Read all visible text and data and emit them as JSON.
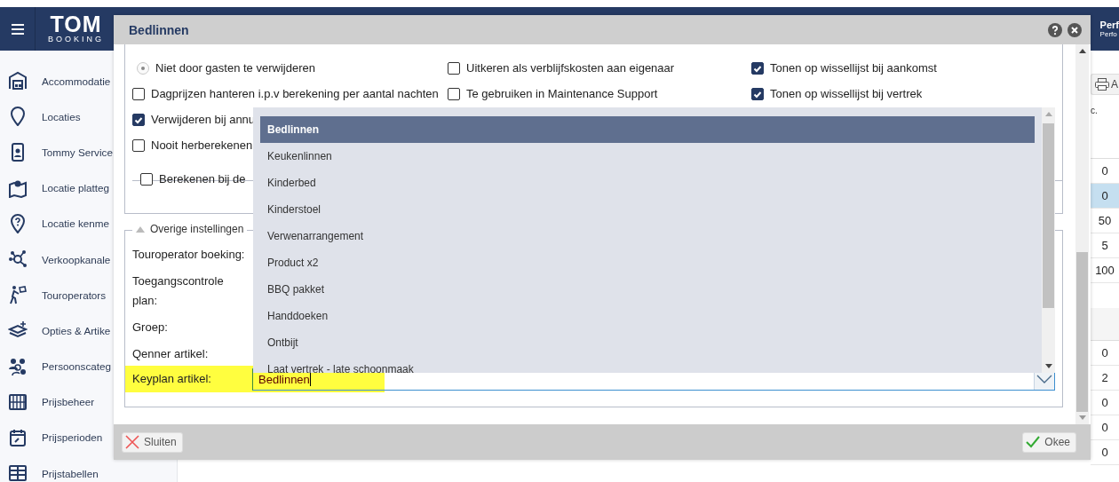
{
  "header": {
    "logo_title": "TOM",
    "logo_subtitle": "BOOKING",
    "user_name": "Perf",
    "user_role": "Perfo"
  },
  "sidebar": {
    "items": [
      {
        "label": "Accommodatie"
      },
      {
        "label": "Locaties"
      },
      {
        "label": "Tommy Service"
      },
      {
        "label": "Locatie platteg"
      },
      {
        "label": "Locatie kenme"
      },
      {
        "label": "Verkoopkanale"
      },
      {
        "label": "Touroperators"
      },
      {
        "label": "Opties & Artike"
      },
      {
        "label": "Persoonscateg"
      },
      {
        "label": "Prijsbeheer"
      },
      {
        "label": "Prijsperioden"
      },
      {
        "label": "Prijstabellen"
      }
    ]
  },
  "background_table": {
    "toolbar_button": "A",
    "column_header": "c.",
    "rows": [
      {
        "value": "0",
        "selected": false
      },
      {
        "value": "0",
        "selected": true
      },
      {
        "value": "50",
        "selected": false
      },
      {
        "value": "5",
        "selected": false
      },
      {
        "value": "100",
        "selected": false
      }
    ],
    "rows_below": [
      {
        "value": "0",
        "selected": false
      },
      {
        "value": "2",
        "selected": false
      },
      {
        "value": "0",
        "selected": false
      },
      {
        "value": "0",
        "selected": false
      },
      {
        "value": "0",
        "selected": false
      }
    ]
  },
  "dialog": {
    "title": "Bedlinnen",
    "option_rows": [
      {
        "cells": [
          {
            "kind": "radio",
            "label": "Niet door gasten te verwijderen",
            "checked": true
          },
          {
            "kind": "checkbox",
            "label": "Uitkeren als verblijfskosten aan eigenaar",
            "checked": false
          },
          {
            "kind": "checkbox",
            "label": "Tonen op wissellijst bij aankomst",
            "checked": true
          }
        ]
      },
      {
        "cells": [
          {
            "kind": "checkbox",
            "label": "Dagprijzen hanteren i.p.v berekening per aantal nachten",
            "checked": false
          },
          {
            "kind": "checkbox",
            "label": "Te gebruiken in Maintenance Support",
            "checked": false
          },
          {
            "kind": "checkbox",
            "label": "Tonen op wissellijst bij vertrek",
            "checked": true
          }
        ]
      },
      {
        "cells": [
          {
            "kind": "checkbox",
            "label": "Verwijderen bij annu",
            "checked": true
          }
        ]
      },
      {
        "cells": [
          {
            "kind": "checkbox",
            "label": "Nooit herberekenen",
            "checked": false
          }
        ]
      }
    ],
    "calc_legend": {
      "label": "Berekenen bij de",
      "checked": false
    },
    "other_settings": {
      "legend": "Overige instellingen",
      "expanded": true,
      "fields": [
        {
          "label": "Touroperator boeking:",
          "highlighted": false
        },
        {
          "label": "Toegangscontrole plan:",
          "highlighted": false
        },
        {
          "label": "Groep:",
          "highlighted": false
        },
        {
          "label": "Qenner artikel:",
          "highlighted": false
        },
        {
          "label": "Keyplan artikel:",
          "highlighted": true,
          "value": "Bedlinnen"
        }
      ]
    },
    "dropdown": {
      "options": [
        {
          "label": "Bedlinnen",
          "selected": true
        },
        {
          "label": "Keukenlinnen",
          "selected": false
        },
        {
          "label": "Kinderbed",
          "selected": false
        },
        {
          "label": "Kinderstoel",
          "selected": false
        },
        {
          "label": "Verwenarrangement",
          "selected": false
        },
        {
          "label": "Product x2",
          "selected": false
        },
        {
          "label": "BBQ pakket",
          "selected": false
        },
        {
          "label": "Handdoeken",
          "selected": false
        },
        {
          "label": "Ontbijt",
          "selected": false
        },
        {
          "label": "Laat vertrek - late schoonmaak",
          "selected": false
        }
      ]
    },
    "footer": {
      "close_button": "Sluiten",
      "ok_button": "Okee"
    }
  }
}
